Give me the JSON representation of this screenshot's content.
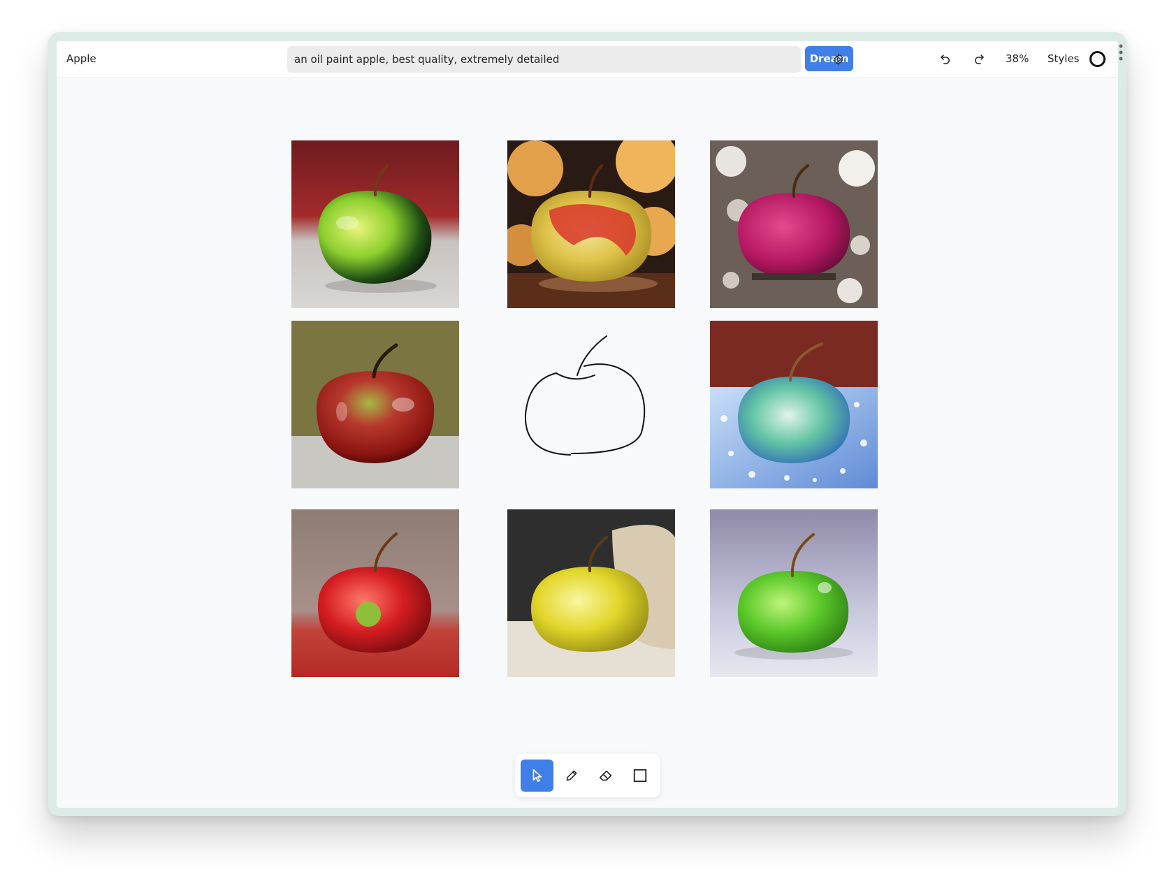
{
  "app": {
    "title": "Apple"
  },
  "prompt": {
    "value": "an oil paint apple, best quality, extremely detailed"
  },
  "actions": {
    "dream_label": "Dream"
  },
  "view": {
    "zoom": "38%",
    "styles_label": "Styles"
  },
  "canvas": {
    "tiles": [
      {
        "name": "green-apple-red-backdrop"
      },
      {
        "name": "yellow-red-apple-wood"
      },
      {
        "name": "magenta-apple-gravel"
      },
      {
        "name": "red-green-apple-burlap"
      },
      {
        "name": "apple-sketch"
      },
      {
        "name": "blue-green-apple-blue-cloth"
      },
      {
        "name": "red-apple-red-surface"
      },
      {
        "name": "yellow-apple-napkin"
      },
      {
        "name": "green-apple-grey-backdrop"
      }
    ]
  },
  "toolbar": {
    "tools": [
      {
        "icon": "pointer-icon",
        "active": true
      },
      {
        "icon": "pencil-icon",
        "active": false
      },
      {
        "icon": "eraser-icon",
        "active": false
      },
      {
        "icon": "square-icon",
        "active": false
      }
    ]
  },
  "colors": {
    "accent": "#3f7fe7",
    "canvas": "#f8f9fa"
  }
}
